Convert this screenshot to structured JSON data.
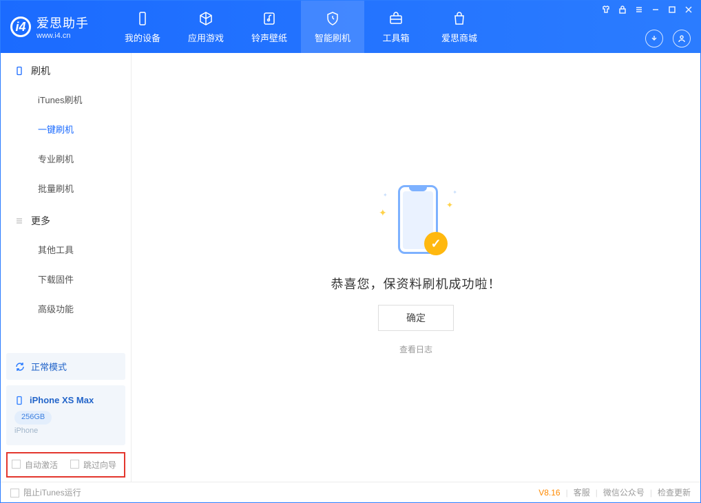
{
  "app": {
    "title": "爱思助手",
    "url": "www.i4.cn"
  },
  "nav": [
    {
      "label": "我的设备",
      "icon": "device-icon"
    },
    {
      "label": "应用游戏",
      "icon": "cube-icon"
    },
    {
      "label": "铃声壁纸",
      "icon": "music-icon"
    },
    {
      "label": "智能刷机",
      "icon": "shield-icon"
    },
    {
      "label": "工具箱",
      "icon": "toolbox-icon"
    },
    {
      "label": "爱思商城",
      "icon": "bag-icon"
    }
  ],
  "sidebar": {
    "section1": "刷机",
    "items1": [
      "iTunes刷机",
      "一键刷机",
      "专业刷机",
      "批量刷机"
    ],
    "section2": "更多",
    "items2": [
      "其他工具",
      "下载固件",
      "高级功能"
    ]
  },
  "mode": {
    "label": "正常模式"
  },
  "device": {
    "name": "iPhone XS Max",
    "capacity": "256GB",
    "type": "iPhone"
  },
  "options": {
    "auto_activate": "自动激活",
    "skip_guide": "跳过向导"
  },
  "main": {
    "success_text": "恭喜您，保资料刷机成功啦！",
    "ok": "确定",
    "view_log": "查看日志"
  },
  "status": {
    "block_itunes": "阻止iTunes运行",
    "version": "V8.16",
    "support": "客服",
    "wechat": "微信公众号",
    "update": "检查更新"
  }
}
